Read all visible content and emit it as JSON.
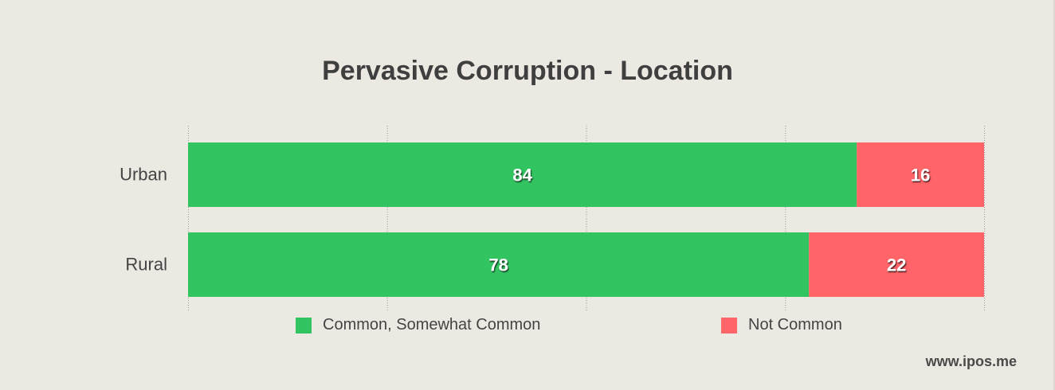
{
  "chart_data": {
    "type": "bar",
    "orientation": "horizontal",
    "stacked": true,
    "title": "Pervasive Corruption - Location",
    "categories": [
      "Urban",
      "Rural"
    ],
    "series": [
      {
        "name": "Common, Somewhat Common",
        "values": [
          84,
          78
        ],
        "color": "#33c462"
      },
      {
        "name": "Not Common",
        "values": [
          16,
          22
        ],
        "color": "#ff6468"
      }
    ],
    "xlim": [
      0,
      100
    ],
    "grid": true,
    "legend": "bottom"
  },
  "footer": {
    "watermark": "www.ipos.me"
  }
}
